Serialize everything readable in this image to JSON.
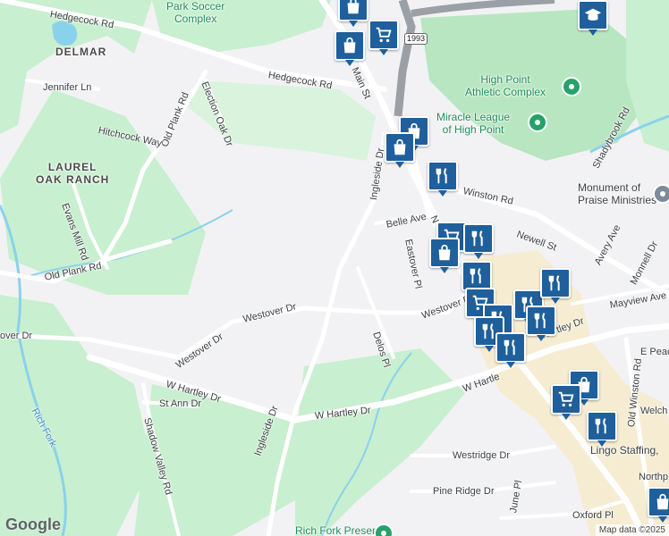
{
  "map": {
    "colors": {
      "background": "#f2f2f4",
      "park": "#c8efcf",
      "road": "#ffffff",
      "highway": "#9aa0a6",
      "water": "#8ad2ec",
      "commercial": "#f5ecd2",
      "marker": "#1f5f9b"
    },
    "roads": [
      {
        "id": "hedgecock-rd-upper",
        "label": "Hedgecock Rd"
      },
      {
        "id": "hedgecock-rd",
        "label": "Hedgecock Rd"
      },
      {
        "id": "main-st",
        "label": "Main St"
      },
      {
        "id": "jennifer-ln",
        "label": "Jennifer Ln"
      },
      {
        "id": "election-oak-dr",
        "label": "Election Oak Dr"
      },
      {
        "id": "old-plank-rd-north",
        "label": "Old Plank Rd"
      },
      {
        "id": "hitchcock-way",
        "label": "Hitchcock Way"
      },
      {
        "id": "evans-mill-rd",
        "label": "Evans Mill Rd"
      },
      {
        "id": "old-plank-rd",
        "label": "Old Plank Rd"
      },
      {
        "id": "ingleside-dr-north",
        "label": "Ingleside Dr"
      },
      {
        "id": "belle-ave",
        "label": "Belle Ave"
      },
      {
        "id": "n-winston-rd",
        "label": "N"
      },
      {
        "id": "winston-rd",
        "label": "Winston Rd"
      },
      {
        "id": "eastover-pl",
        "label": "Eastover Pl"
      },
      {
        "id": "newell-st",
        "label": "Newell St"
      },
      {
        "id": "avery-ave",
        "label": "Avery Ave"
      },
      {
        "id": "shadybrook-rd",
        "label": "Shadybrook Rd"
      },
      {
        "id": "monnell-dr",
        "label": "Monnell Dr"
      },
      {
        "id": "mayview-ave",
        "label": "Mayview Ave"
      },
      {
        "id": "westover-dr-east",
        "label": "Westover Dr"
      },
      {
        "id": "westover-dr",
        "label": "Westover Dr"
      },
      {
        "id": "westover-dr-west",
        "label": "Westover Dr"
      },
      {
        "id": "over-dr",
        "label": "over Dr"
      },
      {
        "id": "delos-pl",
        "label": "Delos Pl"
      },
      {
        "id": "hartley-dr-east",
        "label": "Hartley Dr"
      },
      {
        "id": "e-peace",
        "label": "E Peac"
      },
      {
        "id": "w-hartley-dr-west",
        "label": "W Hartley Dr"
      },
      {
        "id": "w-hartley-dr",
        "label": "W Hartley Dr"
      },
      {
        "id": "w-hartley-dr-east",
        "label": "W Hartle"
      },
      {
        "id": "st-ann-dr",
        "label": "St Ann Dr"
      },
      {
        "id": "shadow-valley-rd",
        "label": "Shadow Valley Rd"
      },
      {
        "id": "ingleside-dr",
        "label": "Ingleside Dr"
      },
      {
        "id": "westridge-dr",
        "label": "Westridge Dr"
      },
      {
        "id": "pine-ridge-dr",
        "label": "Pine Ridge Dr"
      },
      {
        "id": "june-pl",
        "label": "June Pl"
      },
      {
        "id": "oxford-pl",
        "label": "Oxford Pl"
      },
      {
        "id": "old-winston-rd",
        "label": "Old Winston Rd"
      },
      {
        "id": "welch",
        "label": "Welch"
      },
      {
        "id": "northp",
        "label": "Northp"
      },
      {
        "id": "rich-fork",
        "label": "Rich Fork"
      }
    ],
    "areas": [
      {
        "id": "delmar",
        "label": "DELMAR"
      },
      {
        "id": "laurel-oak-ranch",
        "label": "LAUREL\nOAK RANCH"
      }
    ],
    "pois": [
      {
        "id": "park-soccer-complex",
        "label": "Park Soccer\nComplex"
      },
      {
        "id": "high-point-athletic-complex",
        "label": "High Point\nAthletic Complex"
      },
      {
        "id": "miracle-league",
        "label": "Miracle League\nof High Point"
      },
      {
        "id": "monument-of-praise",
        "label": "Monument of\nPraise Ministries"
      },
      {
        "id": "lingo-staffing",
        "label": "Lingo Staffing,"
      },
      {
        "id": "rich-fork-preserve",
        "label": "Rich Fork Preserve"
      }
    ],
    "route_shield": "1993",
    "markers": [
      {
        "type": "shopping"
      },
      {
        "type": "shopping"
      },
      {
        "type": "grocery"
      },
      {
        "type": "shopping"
      },
      {
        "type": "shopping"
      },
      {
        "type": "school"
      },
      {
        "type": "restaurant"
      },
      {
        "type": "grocery"
      },
      {
        "type": "restaurant"
      },
      {
        "type": "shopping"
      },
      {
        "type": "restaurant"
      },
      {
        "type": "grocery"
      },
      {
        "type": "restaurant"
      },
      {
        "type": "restaurant"
      },
      {
        "type": "restaurant"
      },
      {
        "type": "restaurant"
      },
      {
        "type": "restaurant"
      },
      {
        "type": "restaurant"
      },
      {
        "type": "shopping"
      },
      {
        "type": "grocery"
      },
      {
        "type": "restaurant"
      },
      {
        "type": "shopping"
      }
    ],
    "logo": "Google",
    "attribution": "Map data ©2025"
  }
}
